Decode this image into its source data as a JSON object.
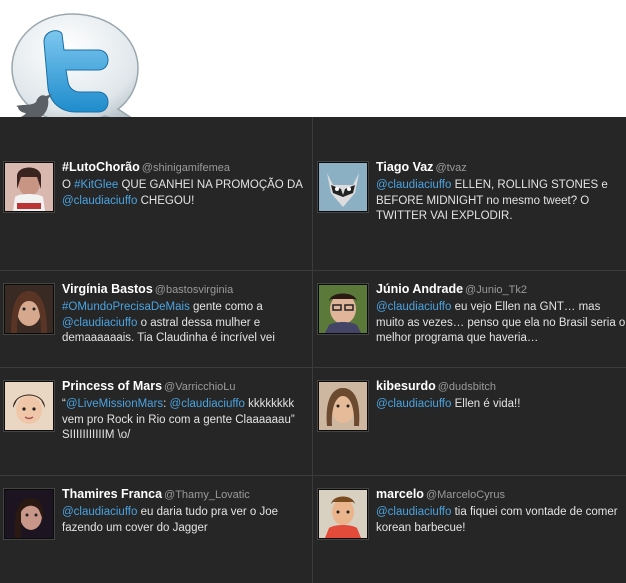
{
  "brand": {
    "logo_icon": "twitter-bird-bubble-icon",
    "accent": "#4aa3e0",
    "background": "#262626"
  },
  "tweets": [
    {
      "name": "#LutoChorão",
      "handle": "@shinigamifemea",
      "parts": [
        {
          "t": "O ",
          "c": "txt"
        },
        {
          "t": "#KitGlee",
          "c": "link"
        },
        {
          "t": " QUE GANHEI NA PROMOÇÃO DA ",
          "c": "txt"
        },
        {
          "t": "@claudiaciuffo",
          "c": "link"
        },
        {
          "t": " CHEGOU!",
          "c": "txt"
        }
      ]
    },
    {
      "name": "Tiago Vaz",
      "handle": "@tvaz",
      "parts": [
        {
          "t": "@claudiaciuffo",
          "c": "link"
        },
        {
          "t": " ELLEN, ROLLING STONES e BEFORE MIDNIGHT no mesmo tweet? O TWITTER VAI EXPLODIR.",
          "c": "txt"
        }
      ]
    },
    {
      "name": "Virgínia Bastos",
      "handle": "@bastosvirginia",
      "parts": [
        {
          "t": "#OMundoPrecisaDeMais",
          "c": "link"
        },
        {
          "t": " gente como a ",
          "c": "txt"
        },
        {
          "t": "@claudiaciuffo",
          "c": "link"
        },
        {
          "t": " o astral dessa mulher e demaaaaaais. Tia Claudinha é incrível vei",
          "c": "txt"
        }
      ]
    },
    {
      "name": "Júnio Andrade",
      "handle": "@Junio_Tk2",
      "parts": [
        {
          "t": "@claudiaciuffo",
          "c": "link"
        },
        {
          "t": " eu vejo Ellen na GNT… mas muito as vezes… penso que ela no Brasil seria o melhor programa que haveria…",
          "c": "txt"
        }
      ]
    },
    {
      "name": "Princess of Mars",
      "handle": "@VarricchioLu",
      "parts": [
        {
          "t": "“",
          "c": "txt"
        },
        {
          "t": "@LiveMissionMars",
          "c": "link"
        },
        {
          "t": ": ",
          "c": "txt"
        },
        {
          "t": "@claudiaciuffo",
          "c": "link"
        },
        {
          "t": " kkkkkkkk vem pro Rock in Rio com a gente Claaaaaau” SIIIIIIIIIIIM \\o/",
          "c": "txt"
        }
      ]
    },
    {
      "name": "kibesurdo",
      "handle": "@dudsbitch",
      "parts": [
        {
          "t": "@claudiaciuffo",
          "c": "link"
        },
        {
          "t": " Ellen é vida!!",
          "c": "txt"
        }
      ]
    },
    {
      "name": "Thamires Franca",
      "handle": "@Thamy_Lovatic",
      "parts": [
        {
          "t": "@claudiaciuffo",
          "c": "link"
        },
        {
          "t": " eu daria tudo pra ver o Joe fazendo um cover do Jagger",
          "c": "txt"
        }
      ]
    },
    {
      "name": "marcelo",
      "handle": "@MarceloCyrus",
      "parts": [
        {
          "t": "@claudiaciuffo",
          "c": "link"
        },
        {
          "t": " tia fiquei com vontade de comer korean barbecue!",
          "c": "txt"
        }
      ]
    }
  ]
}
